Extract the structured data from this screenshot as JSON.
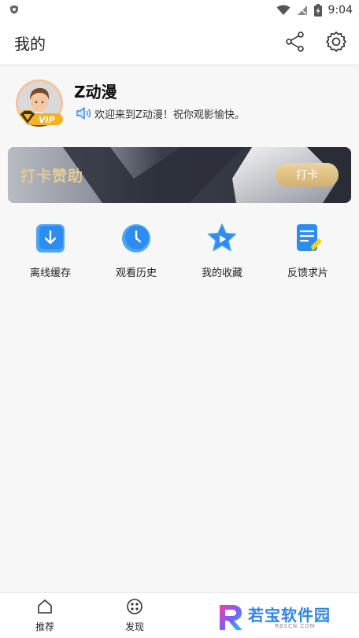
{
  "status_bar": {
    "time": "9:04"
  },
  "header": {
    "title": "我的"
  },
  "profile": {
    "username": "Z动漫",
    "vip_label": "VIP",
    "welcome": "欢迎来到Z动漫！祝你观影愉快。"
  },
  "banner": {
    "title": "打卡赞助",
    "button_label": "打卡"
  },
  "quick_actions": [
    {
      "label": "离线缓存",
      "icon": "download-icon"
    },
    {
      "label": "观看历史",
      "icon": "clock-icon"
    },
    {
      "label": "我的收藏",
      "icon": "star-play-icon"
    },
    {
      "label": "反馈求片",
      "icon": "feedback-note-icon"
    }
  ],
  "bottom_nav": [
    {
      "label": "推荐",
      "icon": "home-icon"
    },
    {
      "label": "发现",
      "icon": "discover-icon"
    }
  ],
  "watermark": {
    "title": "若宝软件园",
    "sub": "RBSCN.COM"
  },
  "colors": {
    "accent_blue": "#2d8cf0",
    "gold": "#e5c993",
    "banner_bg": "#2c303b"
  }
}
